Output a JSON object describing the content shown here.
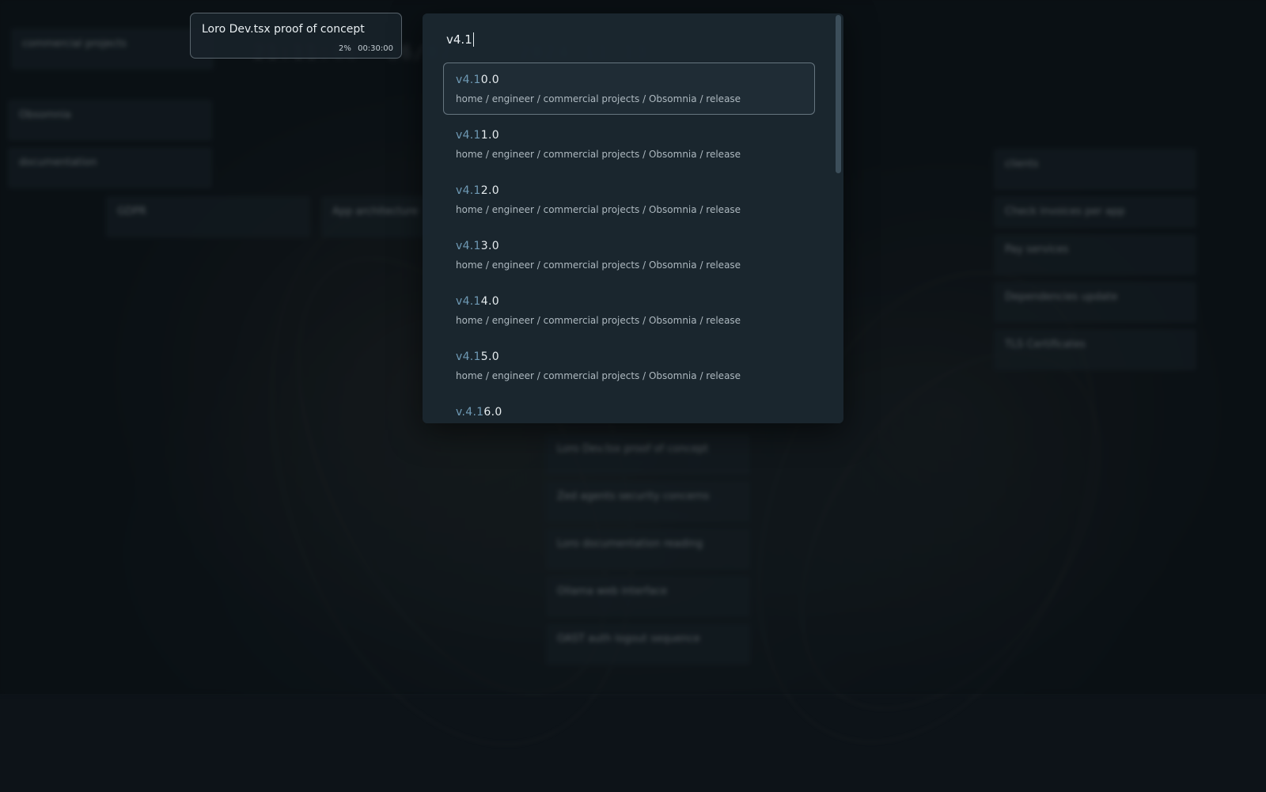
{
  "task_chip": {
    "title": "Loro Dev.tsx proof of concept",
    "progress": "2%",
    "time": "00:30:00"
  },
  "palette": {
    "query": "v4.1",
    "results": [
      {
        "match": "v4.1",
        "rest": "0.0",
        "path": "home / engineer / commercial projects / Obsomnia / release"
      },
      {
        "match": "v4.1",
        "rest": "1.0",
        "path": "home / engineer / commercial projects / Obsomnia / release"
      },
      {
        "match": "v4.1",
        "rest": "2.0",
        "path": "home / engineer / commercial projects / Obsomnia / release"
      },
      {
        "match": "v4.1",
        "rest": "3.0",
        "path": "home / engineer / commercial projects / Obsomnia / release"
      },
      {
        "match": "v4.1",
        "rest": "4.0",
        "path": "home / engineer / commercial projects / Obsomnia / release"
      },
      {
        "match": "v4.1",
        "rest": "5.0",
        "path": "home / engineer / commercial projects / Obsomnia / release"
      },
      {
        "match": "v.4.1",
        "rest": "6.0",
        "path": ""
      }
    ]
  },
  "background": {
    "cards": [
      {
        "title": "commercial projects",
        "meta": ""
      },
      {
        "title": "Obsomnia",
        "meta": ""
      },
      {
        "title": "documentation",
        "meta": ""
      },
      {
        "title": "GDPR",
        "meta": ""
      },
      {
        "title": "App architecture",
        "meta": ""
      },
      {
        "title": "clients",
        "meta": ""
      },
      {
        "title": "Check invoices per app",
        "meta": ""
      },
      {
        "title": "Pay services",
        "meta": ""
      },
      {
        "title": "Dependencies update",
        "meta": ""
      },
      {
        "title": "TLS Certificates",
        "meta": ""
      },
      {
        "title": "Loro Dev.tsx proof of concept",
        "meta": ""
      },
      {
        "title": "Zed agents security concerns",
        "meta": ""
      },
      {
        "title": "Loro documentation reading",
        "meta": ""
      },
      {
        "title": "Ollama web interface",
        "meta": ""
      },
      {
        "title": "OAST auth logout sequence",
        "meta": ""
      }
    ]
  }
}
